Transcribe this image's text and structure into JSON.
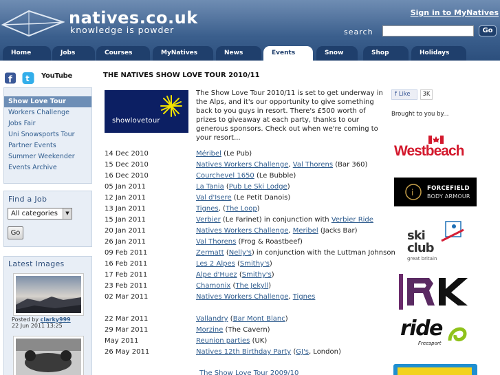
{
  "header": {
    "brand": "natives.co.uk",
    "tagline": "knowledge is powder",
    "signin": "Sign in to MyNatives",
    "search_label": "search",
    "search_placeholder": "",
    "go_label": "Go"
  },
  "nav": {
    "tabs": [
      {
        "label": "Home"
      },
      {
        "label": "Jobs"
      },
      {
        "label": "Courses"
      },
      {
        "label": "MyNatives"
      },
      {
        "label": "News"
      },
      {
        "label": "Events",
        "active": true
      },
      {
        "label": "Snow"
      },
      {
        "label": "Shop"
      },
      {
        "label": "Holidays"
      }
    ]
  },
  "social": {
    "youtube": "YouTube"
  },
  "sidebar": {
    "menu": [
      {
        "label": "Show Love Tour",
        "active": true
      },
      {
        "label": "Workers Challenge"
      },
      {
        "label": "Jobs Fair"
      },
      {
        "label": "Uni Snowsports Tour"
      },
      {
        "label": "Partner Events"
      },
      {
        "label": "Summer Weekender"
      },
      {
        "label": "Events Archive"
      }
    ],
    "find_job": {
      "title": "Find a Job",
      "select_value": "All categories",
      "go_label": "Go"
    },
    "latest_images": {
      "title": "Latest Images",
      "items": [
        {
          "posted_by_label": "Posted by",
          "user": "clarky999",
          "date": "22 Jun 2011 13:25"
        }
      ]
    }
  },
  "main": {
    "title": "THE NATIVES SHOW LOVE TOUR 2010/11",
    "banner_text": "showlovetour",
    "intro": "The Show Love Tour 2010/11 is set to get underway in the Alps, and it's our opportunity to give something back to you guys in resort. There's £500 worth of prizes to giveaway at each party, thanks to our generous sponsors. Check out when we're coming to your resort...",
    "events": [
      {
        "date": "14 Dec 2010",
        "parts": [
          {
            "t": "Méribel",
            "l": true
          },
          {
            "t": " (Le Pub)"
          }
        ]
      },
      {
        "date": "15 Dec 2010",
        "parts": [
          {
            "t": "Natives Workers Challenge",
            "l": true
          },
          {
            "t": ", "
          },
          {
            "t": "Val Thorens",
            "l": true
          },
          {
            "t": " (Bar 360)"
          }
        ]
      },
      {
        "date": "16 Dec 2010",
        "parts": [
          {
            "t": "Courchevel 1650",
            "l": true
          },
          {
            "t": " (Le Bubble)"
          }
        ]
      },
      {
        "date": "05 Jan 2011",
        "parts": [
          {
            "t": "La Tania",
            "l": true
          },
          {
            "t": " ("
          },
          {
            "t": "Pub Le Ski Lodge",
            "l": true
          },
          {
            "t": ")"
          }
        ]
      },
      {
        "date": "12 Jan 2011",
        "parts": [
          {
            "t": "Val d'Isere",
            "l": true
          },
          {
            "t": " (Le Petit Danois)"
          }
        ]
      },
      {
        "date": "13 Jan 2011",
        "parts": [
          {
            "t": "Tignes",
            "l": true
          },
          {
            "t": ", ("
          },
          {
            "t": "The Loop",
            "l": true
          },
          {
            "t": ")"
          }
        ]
      },
      {
        "date": "15 Jan 2011",
        "parts": [
          {
            "t": "Verbier",
            "l": true
          },
          {
            "t": " (Le Farinet) in conjunction with "
          },
          {
            "t": "Verbier Ride",
            "l": true
          }
        ]
      },
      {
        "date": "20 Jan 2011",
        "parts": [
          {
            "t": "Natives Workers Challenge",
            "l": true
          },
          {
            "t": ", "
          },
          {
            "t": "Meribel",
            "l": true
          },
          {
            "t": " (Jacks Bar)"
          }
        ]
      },
      {
        "date": "26 Jan 2011",
        "parts": [
          {
            "t": "Val Thorens",
            "l": true
          },
          {
            "t": " (Frog & Roastbeef)"
          }
        ]
      },
      {
        "date": "09 Feb 2011",
        "parts": [
          {
            "t": "Zermatt",
            "l": true
          },
          {
            "t": " ("
          },
          {
            "t": "Nelly's",
            "l": true
          },
          {
            "t": ") in conjunction with the Luttman Johnson"
          }
        ]
      },
      {
        "date": "16 Feb 2011",
        "parts": [
          {
            "t": "Les 2 Alpes",
            "l": true
          },
          {
            "t": " ("
          },
          {
            "t": "Smithy's",
            "l": true
          },
          {
            "t": ")"
          }
        ]
      },
      {
        "date": "17 Feb 2011",
        "parts": [
          {
            "t": "Alpe d'Huez",
            "l": true
          },
          {
            "t": " ("
          },
          {
            "t": "Smithy's",
            "l": true
          },
          {
            "t": ")"
          }
        ]
      },
      {
        "date": "23 Feb 2011",
        "parts": [
          {
            "t": "Chamonix",
            "l": true
          },
          {
            "t": " ("
          },
          {
            "t": "The Jekyll",
            "l": true
          },
          {
            "t": ")"
          }
        ]
      },
      {
        "date": "02 Mar 2011",
        "parts": [
          {
            "t": "Natives Workers Challenge",
            "l": true
          },
          {
            "t": ", "
          },
          {
            "t": "Tignes",
            "l": true
          }
        ]
      },
      {
        "date": "22 Mar 2011",
        "parts": [
          {
            "t": "Vallandry",
            "l": true
          },
          {
            "t": " ("
          },
          {
            "t": "Bar Mont Blanc",
            "l": true
          },
          {
            "t": ")"
          }
        ]
      },
      {
        "date": "29 Mar 2011",
        "parts": [
          {
            "t": "Morzine",
            "l": true
          },
          {
            "t": " (The Cavern)"
          }
        ]
      },
      {
        "date": "May 2011",
        "parts": [
          {
            "t": "Reunion parties",
            "l": true
          },
          {
            "t": " (UK)"
          }
        ]
      },
      {
        "date": "26 May 2011",
        "parts": [
          {
            "t": "Natives 12th Birthday Party",
            "l": true
          },
          {
            "t": " ("
          },
          {
            "t": "GJ's",
            "l": true
          },
          {
            "t": ", London)"
          }
        ]
      }
    ],
    "past_link": "The Show Love Tour 2009/10"
  },
  "right": {
    "like_label": "Like",
    "like_count": "3K",
    "brought": "Brought to you by...",
    "sponsors": {
      "westbeach": "Westbeach",
      "forcefield_1": "FORCEFIELD",
      "forcefield_2": "BODY ARMOUR",
      "skiclub_1": "ski",
      "skiclub_2": "club",
      "skiclub_3": "great britain",
      "ride": "ride",
      "ride_sub": "Freesport"
    }
  },
  "colors": {
    "header_dark": "#2c4f7d",
    "tab": "#1f3f6c",
    "link": "#2f5c8e",
    "menu_active": "#6d8eb6",
    "banner": "#0c1f63"
  }
}
